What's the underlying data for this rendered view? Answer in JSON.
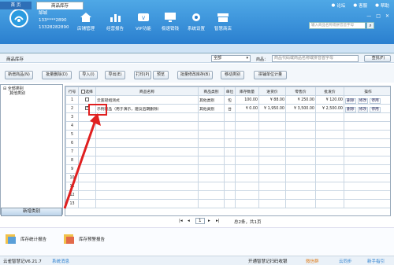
{
  "header": {
    "user_name": "郜城",
    "phone1": "133****2890",
    "phone2": "13328282890",
    "nav": [
      "店铺管理",
      "经营报告",
      "VIP功能",
      "极速销钱",
      "系统设置",
      "智慧商店"
    ],
    "top_links": [
      "论坛",
      "客服",
      "帮助"
    ],
    "search_placeholder": "输入商品名称或拼音首字母"
  },
  "tabs": [
    "首 页",
    "商品库存"
  ],
  "subbar": {
    "title": "商品库存",
    "select_value": "全部",
    "filter_label": "商品：",
    "filter_placeholder": "商品代码或商品名称或拼音首字母",
    "query_button": "查找(F)"
  },
  "toolbar": [
    "新增商品(N)",
    "批量删除(D)",
    "导入(I)",
    "导出(E)",
    "打印(P)",
    "预览",
    "批量修改库存(B)",
    "移动类别",
    "拼辅单位计量"
  ],
  "tree": {
    "root": "全部类别",
    "child": "其他类别",
    "new_category": "新增类别"
  },
  "table": {
    "headers": [
      "行号",
      "选择",
      "商品名称",
      "商品类别",
      "单位",
      "库存数量",
      "进货价",
      "零售价",
      "批发价",
      "操作"
    ],
    "rows": [
      {
        "no": "1",
        "checked": false,
        "name": "云宽轻组测式",
        "cat": "其他类别",
        "unit": "包",
        "qty": "100.00",
        "cost": "¥ 88.00",
        "retail": "¥ 250.00",
        "whole": "¥ 120.00",
        "ops": [
          "删除",
          "修改",
          "停用"
        ]
      },
      {
        "no": "2",
        "checked": true,
        "name": "示例商品（用于演示，建议后期删除）",
        "cat": "其他类别",
        "unit": "台",
        "qty": "¥ 0.00",
        "cost": "¥ 1,950.00",
        "retail": "¥ 3,500.00",
        "whole": "¥ 2,500.00",
        "ops": [
          "删除",
          "修改",
          "停用"
        ]
      }
    ],
    "empty_rows": [
      "3",
      "4",
      "5",
      "6",
      "7",
      "8",
      "9",
      "10",
      "11",
      "12",
      "13"
    ]
  },
  "pager": {
    "page": "1",
    "info": "总2条，共1页"
  },
  "reports": [
    "库存统计报告",
    "库存预警报告"
  ],
  "status": {
    "version": "云雀智慧记V6.21.7",
    "msg": "系统消息",
    "center": "开通智慧记扫码收银",
    "right1": "微信群",
    "right2": "云同步",
    "right3": "新手指引"
  },
  "colors": {
    "top": "#2a7fcf",
    "accent": "#e02020"
  }
}
